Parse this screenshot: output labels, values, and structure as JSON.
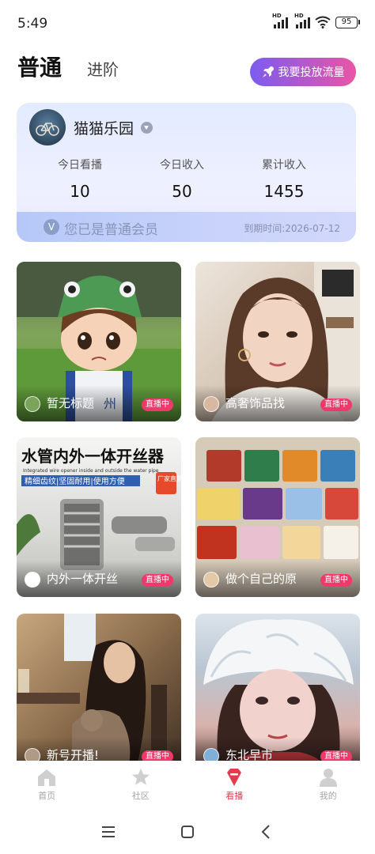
{
  "status_bar": {
    "time": "5:49",
    "battery": "95",
    "hd1": "HD",
    "hd2": "HD"
  },
  "header": {
    "tab_active": "普通",
    "tab_inactive": "进阶",
    "promo_button": "我要投放流量"
  },
  "member_card": {
    "account_name": "猫猫乐园",
    "stats": [
      {
        "label": "今日看播",
        "value": "10"
      },
      {
        "label": "今日收入",
        "value": "50"
      },
      {
        "label": "累计收入",
        "value": "1455"
      }
    ],
    "vip_icon": "V",
    "vip_text": "您已是普通会员",
    "expire_text": "到期时间:2026-07-12"
  },
  "streams": [
    {
      "title": "暂无标题",
      "badge": "直播中",
      "tile_text": "州"
    },
    {
      "title": "高奢饰品找",
      "badge": "直播中"
    },
    {
      "title": "内外一体开丝",
      "badge": "直播中",
      "banner": "水管内外一体开丝器",
      "banner_en": "Integrated wire opener inside and outside the water pipe",
      "features": "精细齿纹|坚固耐用|使用方便",
      "tag": "厂家直销"
    },
    {
      "title": "做个自己的原",
      "badge": "直播中"
    },
    {
      "title": "新号开播!",
      "badge": "直播中"
    },
    {
      "title": "东北早市",
      "badge": "直播中"
    }
  ],
  "bottom_nav": [
    {
      "label": "首页",
      "icon": "home-icon"
    },
    {
      "label": "社区",
      "icon": "star-icon"
    },
    {
      "label": "看播",
      "icon": "gem-icon",
      "active": true
    },
    {
      "label": "我的",
      "icon": "user-icon"
    }
  ],
  "colors": {
    "accent": "#e53b4f",
    "live_badge": "#f0386b",
    "promo_start": "#7b5cf0",
    "promo_end": "#e955a6"
  }
}
